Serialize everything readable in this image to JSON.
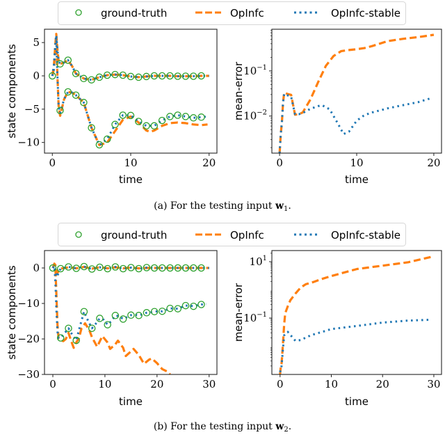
{
  "legend": {
    "entries": [
      {
        "label": "ground-truth",
        "color": "#2ca02c",
        "style": "circle"
      },
      {
        "label": "OpInfc",
        "color": "#ff7f0e",
        "style": "dashed"
      },
      {
        "label": "OpInfc-stable",
        "color": "#1f77b4",
        "style": "dotted"
      }
    ]
  },
  "captions": {
    "a": {
      "prefix": "(a) For the testing input ",
      "symbol": "w",
      "sub": "1",
      "suffix": "."
    },
    "b": {
      "prefix": "(b) For the testing input ",
      "symbol": "w",
      "sub": "2",
      "suffix": "."
    }
  },
  "chart_data": [
    {
      "id": "a-left",
      "type": "line",
      "xlabel": "time",
      "ylabel": "state components",
      "xlim": [
        -1,
        21
      ],
      "ylim": [
        -11.6,
        7.0
      ],
      "xticks": [
        0,
        10,
        20
      ],
      "xtick_labels": [
        "0",
        "10",
        "20"
      ],
      "yticks": [
        5,
        0,
        -5,
        -10
      ],
      "ytick_labels": [
        "5",
        "0",
        "−5",
        "−10"
      ],
      "yscale": "linear",
      "series": [
        {
          "name": "ground-truth",
          "component": 1,
          "x": [
            0,
            1,
            2,
            3,
            4,
            5,
            6,
            7,
            8,
            9,
            10,
            11,
            12,
            13,
            14,
            15,
            16,
            17,
            18,
            19
          ],
          "y": [
            0,
            1.8,
            2.35,
            0.35,
            -0.4,
            -0.6,
            -0.2,
            0.1,
            0.2,
            0.1,
            -0.1,
            -0.2,
            -0.1,
            0,
            0,
            0,
            -0.05,
            -0.05,
            -0.05,
            0
          ]
        },
        {
          "name": "ground-truth",
          "component": 2,
          "x": [
            1,
            2,
            3,
            4,
            5,
            6,
            7,
            8,
            9,
            10,
            11,
            12,
            13,
            14,
            15,
            16,
            17,
            18,
            19
          ],
          "y": [
            -5.2,
            -2.4,
            -2.9,
            -4.0,
            -7.8,
            -10.35,
            -9.5,
            -7.3,
            -5.9,
            -5.95,
            -6.85,
            -7.5,
            -7.5,
            -6.7,
            -6.1,
            -5.9,
            -6.1,
            -6.3,
            -6.2
          ]
        },
        {
          "name": "OpInfc",
          "component": 1,
          "x": [
            0,
            0.2,
            0.4,
            0.5,
            0.65,
            0.8,
            1,
            1.5,
            2,
            2.5,
            3,
            4,
            5,
            6,
            7,
            8,
            9,
            10,
            11,
            12,
            13,
            14,
            15,
            16,
            17,
            18,
            19,
            20
          ],
          "y": [
            0,
            1.5,
            5,
            6.3,
            4,
            2.2,
            1.8,
            2.0,
            2.35,
            1.5,
            0.35,
            -0.4,
            -0.6,
            -0.2,
            0.1,
            0.2,
            0.1,
            -0.1,
            -0.2,
            -0.1,
            0,
            0,
            0,
            -0.05,
            -0.05,
            -0.05,
            0,
            0
          ]
        },
        {
          "name": "OpInfc",
          "component": 2,
          "x": [
            0,
            0.2,
            0.4,
            0.5,
            0.65,
            0.8,
            1,
            1.5,
            2,
            2.5,
            3,
            4,
            5,
            6,
            7,
            8,
            9,
            10,
            11,
            12,
            12.5,
            13,
            14,
            15,
            16,
            17,
            18,
            19,
            19.8
          ],
          "y": [
            0,
            1,
            4.5,
            6.0,
            0,
            -4.5,
            -6.0,
            -3.5,
            -2.4,
            -2.5,
            -2.9,
            -4.0,
            -7.8,
            -10.4,
            -10.0,
            -8.3,
            -6.6,
            -6.1,
            -7.0,
            -8.2,
            -8.4,
            -8.2,
            -7.5,
            -7.1,
            -7.0,
            -7.1,
            -7.3,
            -7.4,
            -7.3
          ]
        },
        {
          "name": "OpInfc-stable",
          "component": 1,
          "x": [
            0,
            0.2,
            0.4,
            0.5,
            0.65,
            0.8,
            1,
            1.5,
            2,
            2.5,
            3,
            4,
            5,
            6,
            7,
            8,
            9,
            10,
            11,
            12,
            13,
            14,
            15,
            16,
            17,
            18,
            19,
            20
          ],
          "y": [
            0,
            1.5,
            5,
            6.1,
            4,
            2.2,
            1.8,
            2.0,
            2.35,
            1.5,
            0.35,
            -0.4,
            -0.6,
            -0.2,
            0.1,
            0.2,
            0.1,
            -0.1,
            -0.2,
            -0.1,
            0,
            0,
            0,
            -0.05,
            -0.05,
            -0.05,
            0,
            0
          ]
        },
        {
          "name": "OpInfc-stable",
          "component": 2,
          "x": [
            0,
            0.2,
            0.4,
            0.5,
            0.65,
            0.8,
            1,
            1.5,
            2,
            2.5,
            3,
            4,
            5,
            6,
            7,
            8,
            9,
            10,
            11,
            12,
            13,
            14,
            15,
            16,
            17,
            18,
            19,
            19.8
          ],
          "y": [
            0,
            1,
            4.5,
            5.8,
            0,
            -4.5,
            -5.6,
            -3.5,
            -2.4,
            -2.5,
            -2.9,
            -4.0,
            -7.8,
            -10.4,
            -9.5,
            -7.3,
            -5.9,
            -5.95,
            -6.85,
            -7.5,
            -7.5,
            -6.7,
            -6.1,
            -5.9,
            -6.1,
            -6.3,
            -6.2,
            -6.1
          ]
        }
      ]
    },
    {
      "id": "a-right",
      "type": "line",
      "xlabel": "time",
      "ylabel": "mean-error",
      "xlim": [
        -1,
        21
      ],
      "ylim": [
        0.00151,
        0.838
      ],
      "xticks": [
        0,
        10,
        20
      ],
      "xtick_labels": [
        "0",
        "10",
        "20"
      ],
      "yticks": [
        0.1,
        0.01
      ],
      "ytick_labels": [
        "10^-1",
        "10^-2"
      ],
      "yscale": "log",
      "series": [
        {
          "name": "OpInfc",
          "x": [
            0,
            0.15,
            0.3,
            0.45,
            0.6,
            1,
            1.5,
            2,
            2.5,
            3,
            4,
            5,
            6,
            7,
            8,
            9,
            10,
            11,
            12,
            14,
            16,
            18,
            20
          ],
          "y": [
            0.0015,
            0.004,
            0.0071,
            0.02,
            0.033,
            0.031,
            0.0295,
            0.0107,
            0.011,
            0.012,
            0.0234,
            0.0562,
            0.129,
            0.214,
            0.275,
            0.29,
            0.302,
            0.32,
            0.355,
            0.457,
            0.513,
            0.562,
            0.631
          ]
        },
        {
          "name": "OpInfc-stable",
          "x": [
            0,
            0.15,
            0.3,
            0.45,
            0.6,
            1,
            1.5,
            2,
            2.5,
            3,
            4,
            5,
            5.5,
            6.5,
            7.5,
            8.3,
            9,
            10,
            11,
            12,
            14,
            16,
            18,
            19.5
          ],
          "y": [
            0.0015,
            0.004,
            0.0071,
            0.02,
            0.031,
            0.029,
            0.027,
            0.011,
            0.011,
            0.0117,
            0.0145,
            0.0166,
            0.0174,
            0.0141,
            0.0071,
            0.004,
            0.0045,
            0.0079,
            0.0105,
            0.012,
            0.0148,
            0.0174,
            0.0204,
            0.0245
          ]
        }
      ]
    },
    {
      "id": "b-left",
      "type": "line",
      "xlabel": "time",
      "ylabel": "state components",
      "xlim": [
        -1.6,
        31.5
      ],
      "ylim": [
        -30,
        4.9
      ],
      "xticks": [
        0,
        10,
        20,
        30
      ],
      "xtick_labels": [
        "0",
        "10",
        "20",
        "30"
      ],
      "yticks": [
        0,
        -10,
        -20,
        -30
      ],
      "ytick_labels": [
        "0",
        "−10",
        "−20",
        "−30"
      ],
      "yscale": "linear",
      "series": [
        {
          "name": "ground-truth",
          "component": 1,
          "x": [
            0,
            1.5,
            3,
            4.5,
            6,
            7.5,
            9,
            10.5,
            12,
            13.5,
            15,
            16.5,
            18,
            19.5,
            21,
            22.5,
            24,
            25.5,
            27,
            28.5
          ],
          "y": [
            0,
            -0.2,
            0.3,
            -0.1,
            0.4,
            -0.3,
            0.2,
            -0.2,
            0.3,
            -0.2,
            0.1,
            -0.2,
            0.1,
            0,
            0,
            0,
            0,
            0,
            0,
            0
          ]
        },
        {
          "name": "ground-truth",
          "component": 2,
          "x": [
            1.5,
            3,
            4.5,
            6,
            7.5,
            9,
            10.5,
            12,
            13.5,
            15,
            16.5,
            18,
            19.5,
            21,
            22.5,
            24,
            25.5,
            27,
            28.5
          ],
          "y": [
            -19.7,
            -17.0,
            -20.4,
            -12.3,
            -17.0,
            -14.2,
            -16.0,
            -13.4,
            -14.4,
            -13.3,
            -13.4,
            -12.6,
            -12.3,
            -12.2,
            -11.4,
            -11.5,
            -10.6,
            -10.8,
            -10.3
          ]
        },
        {
          "name": "OpInfc",
          "component": 1,
          "x": [
            0,
            0.3,
            0.5,
            0.8,
            1.2,
            1.5,
            3,
            4.5,
            6,
            7.5,
            9,
            10.5,
            12,
            13.5,
            15,
            16.5,
            18,
            19.5,
            21,
            22.5,
            24,
            25.5,
            27,
            28.5,
            30
          ],
          "y": [
            0,
            1.2,
            0.8,
            -1.5,
            -0.8,
            -0.2,
            0.2,
            -0.1,
            0.3,
            -0.2,
            0.2,
            -0.1,
            0.2,
            -0.1,
            0.1,
            -0.1,
            0,
            0,
            0,
            0,
            0,
            0,
            0,
            0,
            0
          ]
        },
        {
          "name": "OpInfc",
          "component": 2,
          "x": [
            0,
            0.3,
            0.5,
            0.7,
            0.9,
            1.1,
            1.5,
            2,
            2.5,
            3,
            3.5,
            4,
            4.5,
            5,
            5.5,
            6.2,
            7,
            7.5,
            8.5,
            9.5,
            10.5,
            11,
            12,
            12.5,
            13.5,
            14,
            15,
            15.5,
            16.5,
            17.5,
            18.5,
            19,
            20,
            21,
            22,
            22.5
          ],
          "y": [
            0,
            1.2,
            0,
            -8,
            -16,
            -19.8,
            -20.3,
            -20.6,
            -20.0,
            -18.3,
            -20.5,
            -22.5,
            -21.0,
            -19.8,
            -17.0,
            -15.6,
            -17.5,
            -19.5,
            -22.2,
            -19.2,
            -21.0,
            -22.8,
            -21.5,
            -20.5,
            -22.5,
            -24.8,
            -23.5,
            -22.8,
            -24.5,
            -27.0,
            -25.8,
            -25.5,
            -26.8,
            -28.5,
            -29.2,
            -30
          ]
        },
        {
          "name": "OpInfc-stable",
          "component": 1,
          "x": [
            0,
            0.3,
            0.5,
            0.8,
            1.2,
            1.5,
            3,
            4.5,
            6,
            7.5,
            9,
            10.5,
            12,
            13.5,
            15,
            16.5,
            18,
            19.5,
            21,
            22.5,
            24,
            25.5,
            27,
            28.5,
            30
          ],
          "y": [
            0,
            0.6,
            -0.5,
            -2.5,
            -1.0,
            -0.2,
            0.3,
            -0.1,
            0.4,
            -0.3,
            0.2,
            -0.2,
            0.3,
            -0.2,
            0.1,
            -0.2,
            0.1,
            0,
            0,
            0,
            0,
            0,
            0,
            0,
            0
          ]
        },
        {
          "name": "OpInfc-stable",
          "component": 2,
          "x": [
            0,
            0.3,
            0.5,
            0.7,
            0.9,
            1.1,
            1.5,
            2.2,
            3,
            3.8,
            4.5,
            5.2,
            6,
            6.8,
            7.5,
            8.2,
            9,
            9.8,
            10.5,
            11.2,
            12,
            12.8,
            13.5,
            14.3,
            15,
            15.8,
            16.5,
            17.3,
            18,
            18.8,
            19.5,
            20.3,
            21,
            21.8,
            22.5,
            23.3,
            24,
            24.8,
            25.5,
            26.3,
            27,
            27.8,
            28.5,
            29.5
          ],
          "y": [
            0,
            0.5,
            -4,
            -12,
            -18,
            -19.7,
            -19.7,
            -18.5,
            -17.0,
            -19.0,
            -20.4,
            -16.5,
            -12.3,
            -15.0,
            -17.0,
            -15.8,
            -14.2,
            -14.6,
            -16.0,
            -15.0,
            -13.4,
            -13.6,
            -14.4,
            -13.8,
            -13.3,
            -13.2,
            -13.4,
            -13.0,
            -12.6,
            -12.5,
            -12.3,
            -12.2,
            -12.2,
            -11.8,
            -11.4,
            -11.4,
            -11.5,
            -11.0,
            -10.6,
            -10.6,
            -10.8,
            -10.5,
            -10.3,
            -10.2
          ]
        }
      ]
    },
    {
      "id": "b-right",
      "type": "line",
      "xlabel": "time",
      "ylabel": "mean-error",
      "xlim": [
        -1.6,
        31.5
      ],
      "ylim": [
        0.001,
        24.8
      ],
      "xticks": [
        0,
        10,
        20,
        30
      ],
      "xtick_labels": [
        "0",
        "10",
        "20",
        "30"
      ],
      "yticks": [
        10,
        0.1
      ],
      "ytick_labels": [
        "10^1",
        "10^-1"
      ],
      "yscale": "log",
      "series": [
        {
          "name": "OpInfc",
          "x": [
            0,
            0.15,
            0.3,
            0.45,
            0.6,
            0.8,
            1,
            1.5,
            2,
            3,
            4,
            5,
            6.5,
            8,
            10,
            15,
            20,
            25,
            30
          ],
          "y": [
            0.001,
            0.002,
            0.0025,
            0.006,
            0.0155,
            0.06,
            0.148,
            0.263,
            0.427,
            0.741,
            1.2,
            1.58,
            1.9,
            2.4,
            3.09,
            5.5,
            7.24,
            9.55,
            15.5
          ]
        },
        {
          "name": "OpInfc-stable",
          "x": [
            0,
            0.15,
            0.3,
            0.5,
            0.8,
            1.5,
            3,
            4,
            6,
            8,
            10,
            15,
            20,
            25,
            29.5
          ],
          "y": [
            0.0012,
            0.0016,
            0.002,
            0.0059,
            0.0245,
            0.0324,
            0.0155,
            0.0166,
            0.0245,
            0.0316,
            0.0407,
            0.0525,
            0.0692,
            0.0813,
            0.0871
          ]
        }
      ]
    }
  ]
}
